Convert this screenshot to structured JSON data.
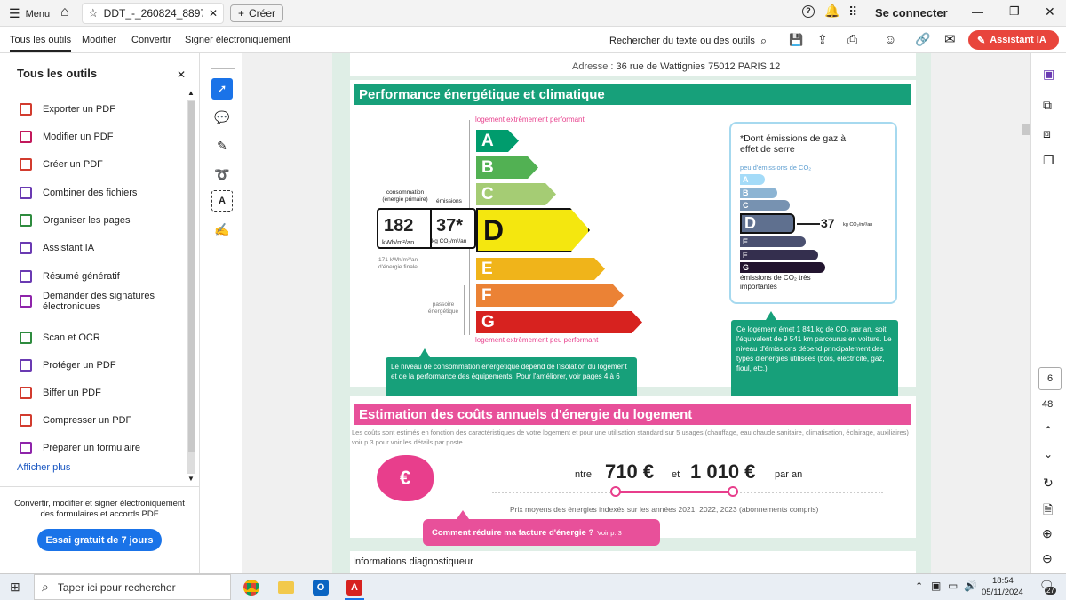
{
  "topbar": {
    "menu_label": "Menu",
    "tab_title": "DDT_-_260824_8897...",
    "create_label": "Créer",
    "connect_label": "Se connecter"
  },
  "menubar": {
    "items": [
      "Tous les outils",
      "Modifier",
      "Convertir",
      "Signer électroniquement"
    ],
    "search_label": "Rechercher du texte ou des outils",
    "assistant_label": "Assistant IA"
  },
  "sidebar": {
    "title": "Tous les outils",
    "items": [
      {
        "label": "Exporter un PDF",
        "color": "#d23b2e"
      },
      {
        "label": "Modifier un PDF",
        "color": "#c2185b"
      },
      {
        "label": "Créer un PDF",
        "color": "#d23b2e"
      },
      {
        "label": "Combiner des fichiers",
        "color": "#6a3ab2"
      },
      {
        "label": "Organiser les pages",
        "color": "#2e8b3e"
      },
      {
        "label": "Assistant IA",
        "color": "#6a3ab2"
      },
      {
        "label": "Résumé génératif",
        "color": "#6a3ab2"
      },
      {
        "label": "Demander des signatures électroniques",
        "color": "#8e24aa"
      },
      {
        "label": "Scan et OCR",
        "color": "#2e8b3e"
      },
      {
        "label": "Protéger un PDF",
        "color": "#6a3ab2"
      },
      {
        "label": "Biffer un PDF",
        "color": "#d23b2e"
      },
      {
        "label": "Compresser un PDF",
        "color": "#d23b2e"
      },
      {
        "label": "Préparer un formulaire",
        "color": "#8e24aa"
      }
    ],
    "show_more": "Afficher plus",
    "promo_text": "Convertir, modifier et signer électroniquement des formulaires et accords PDF",
    "trial_button": "Essai gratuit de 7 jours"
  },
  "doc": {
    "address_label": "Adresse :",
    "address": "36 rue de Wattignies 75012 PARIS 12",
    "perf_title": "Performance énergétique et climatique",
    "top_label": "logement extrêmement performant",
    "bottom_label": "logement extrêmement peu performant",
    "consumption_label": "consommation (énergie primaire)",
    "emissions_label": "émissions",
    "consumption_value": "182",
    "consumption_unit": "kWh/m²/an",
    "emissions_value": "37*",
    "emissions_unit": "kg CO₂/m²/an",
    "final_energy": "171 kWh/m²/an d'énergie finale",
    "passoire_label": "passoire énergétique",
    "classes": [
      "A",
      "B",
      "C",
      "D",
      "E",
      "F",
      "G"
    ],
    "current_class": "D",
    "ges_title": "*Dont émissions de gaz à effet de serre",
    "ges_low": "peu d'émissions de CO₂",
    "ges_high": "émissions de CO₂ très importantes",
    "ges_value": "37",
    "ges_unit": "kg CO₂/m²/an",
    "green_left": "Le niveau de consommation énergétique dépend de l'isolation du logement et de la performance des équipements. Pour l'améliorer, voir pages 4 à 6",
    "green_right": "Ce logement émet 1 841 kg de CO₂ par an, soit l'équivalent de 9 541 km parcourus en voiture. Le niveau d'émissions dépend principalement des types d'énergies utilisées (bois, électricité, gaz, fioul, etc.)",
    "cost_title": "Estimation des coûts annuels d'énergie du logement",
    "cost_desc": "Les coûts sont estimés en fonction des caractéristiques de votre logement et pour une utilisation standard sur 5 usages (chauffage, eau chaude sanitaire, climatisation, éclairage, auxiliaires) voir p.3 pour voir les détails par poste.",
    "between": "ntre",
    "cost_min": "710 €",
    "and": "et",
    "cost_max": "1 010 €",
    "per_year": "par an",
    "prices_note": "Prix moyens des énergies indexés sur les années 2021, 2022, 2023 (abonnements compris)",
    "reduce_label": "Comment réduire ma facture d'énergie ?",
    "reduce_page": "Voir p. 3",
    "diag_label": "Informations diagnostiqueur"
  },
  "rightrail": {
    "page_current": "6",
    "page_total": "48"
  },
  "taskbar": {
    "search_placeholder": "Taper ici pour rechercher",
    "time": "18:54",
    "date": "05/11/2024",
    "badge": "27"
  },
  "colors": {
    "dpe": [
      "#009c6d",
      "#52b153",
      "#a5cc74",
      "#f4e70f",
      "#f0b41a",
      "#eb8235",
      "#d7221f"
    ],
    "ges": [
      "#a4dbf8",
      "#8cb4d3",
      "#7792b1",
      "#5f708f",
      "#4a5070",
      "#342f4e",
      "#22142e"
    ],
    "accent_green": "#17a07a",
    "accent_pink": "#e83e8c"
  }
}
